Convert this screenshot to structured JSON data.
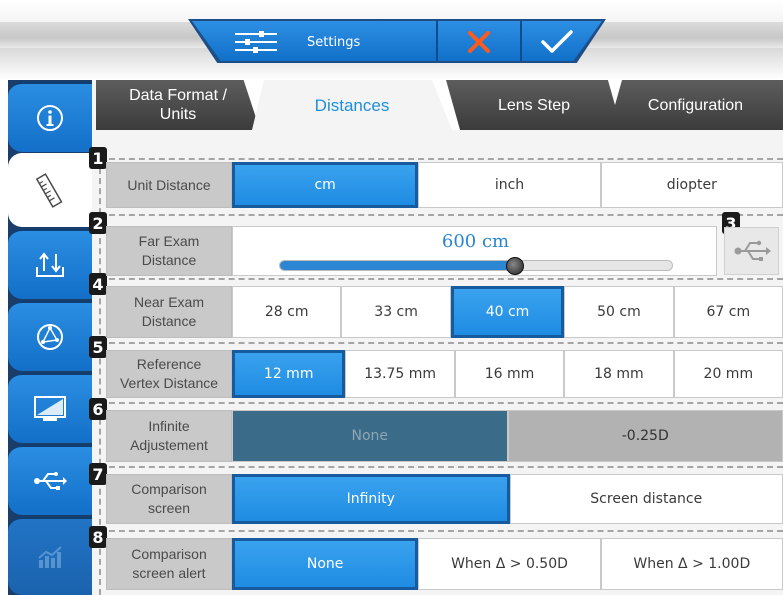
{
  "toolbar": {
    "settings_label": "Settings",
    "icons": {
      "settings": "sliders-icon",
      "cancel": "close-icon",
      "ok": "check-icon"
    },
    "accent": "#1f8ce3",
    "cancel_color": "#ff5a1a"
  },
  "sidebar": {
    "items": [
      {
        "icon": "info-icon"
      },
      {
        "icon": "ruler-icon",
        "active": true
      },
      {
        "icon": "import-export-icon"
      },
      {
        "icon": "network-icon"
      },
      {
        "icon": "monitor-icon"
      },
      {
        "icon": "usb-icon"
      },
      {
        "icon": "chart-icon",
        "disabled": true
      }
    ]
  },
  "tabs": {
    "items": [
      {
        "label": "Data Format /\nUnits"
      },
      {
        "label": "Distances",
        "active": true
      },
      {
        "label": "Lens Step"
      },
      {
        "label": "Configuration"
      }
    ]
  },
  "badges": [
    "1",
    "2",
    "3",
    "4",
    "5",
    "6",
    "7",
    "8"
  ],
  "rows": {
    "unit_distance": {
      "label": "Unit Distance",
      "options": [
        "cm",
        "inch",
        "diopter"
      ],
      "selected": 0
    },
    "far_exam": {
      "label": "Far Exam\nDistance",
      "value": "600 cm",
      "slider_level": 0.6
    },
    "near_exam": {
      "label": "Near Exam\nDistance",
      "options": [
        "28 cm",
        "33 cm",
        "40 cm",
        "50 cm",
        "67 cm"
      ],
      "selected": 2
    },
    "vertex": {
      "label": "Reference\nVertex Distance",
      "options": [
        "12 mm",
        "13.75 mm",
        "16 mm",
        "18 mm",
        "20 mm"
      ],
      "selected": 0
    },
    "infinite": {
      "label": "Infinite\nAdjustement",
      "options": [
        "None",
        "-0.25D"
      ],
      "selected": 0
    },
    "comparison_screen": {
      "label": "Comparison\nscreen",
      "options": [
        "Infinity",
        "Screen distance"
      ],
      "selected": 0
    },
    "comparison_alert": {
      "label": "Comparison\nscreen alert",
      "options": [
        "None",
        "When Δ > 0.50D",
        "When Δ > 1.00D"
      ],
      "selected": 0
    }
  }
}
